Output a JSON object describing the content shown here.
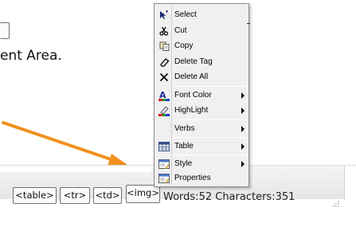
{
  "content": {
    "visible_text": "ent Area."
  },
  "menu": {
    "items": [
      {
        "label": "Select",
        "icon": "cursor-icon",
        "submenu": false
      },
      {
        "label": "Cut",
        "icon": "scissors-icon",
        "submenu": false
      },
      {
        "label": "Copy",
        "icon": "copy-icon",
        "submenu": false
      },
      {
        "label": "Delete Tag",
        "icon": "eraser-icon",
        "submenu": false
      },
      {
        "label": "Delete All",
        "icon": "x-icon",
        "submenu": false
      },
      {
        "label": "Font Color",
        "icon": "font-color-icon",
        "submenu": true
      },
      {
        "label": "HighLight",
        "icon": "highlighter-icon",
        "submenu": true
      },
      {
        "label": "Verbs",
        "icon": "",
        "submenu": true
      },
      {
        "label": "Table",
        "icon": "table-icon",
        "submenu": true
      },
      {
        "label": "Style",
        "icon": "style-icon",
        "submenu": true
      },
      {
        "label": "Properties",
        "icon": "properties-icon",
        "submenu": false
      }
    ]
  },
  "statusbar": {
    "tags": [
      "<table>",
      "<tr>",
      "<td>",
      "<img>"
    ],
    "counts": "Words:52 Characters:351"
  },
  "colors": {
    "arrow": "#f0901e",
    "menu_bg": "#f0f0f0",
    "statusbar_bg": "#eeeeee"
  }
}
